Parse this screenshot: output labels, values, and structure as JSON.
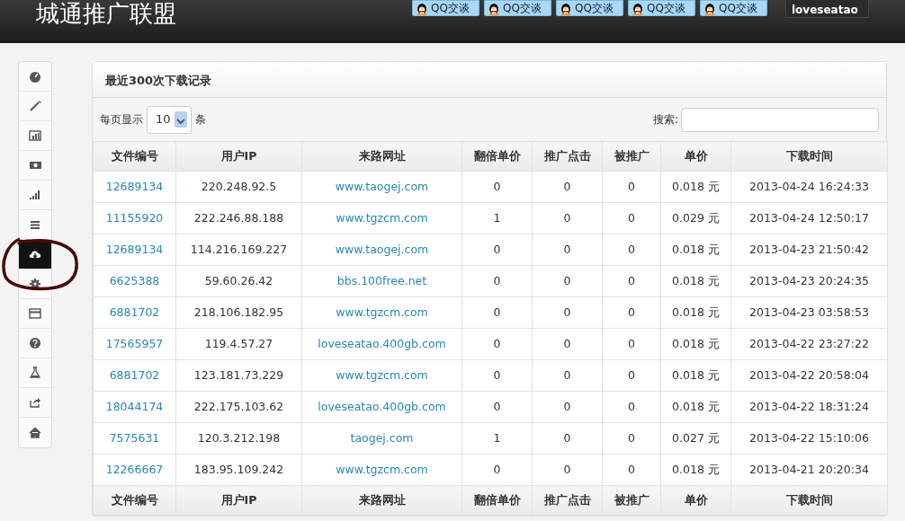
{
  "header": {
    "title": "城通推广联盟",
    "chat_buttons": [
      "QQ交谈",
      "QQ交谈",
      "QQ交谈",
      "QQ交谈",
      "QQ交谈"
    ],
    "username": "loveseatao"
  },
  "sidebar": {
    "items": [
      {
        "kind": "gauge",
        "selected": false
      },
      {
        "kind": "wand",
        "selected": false
      },
      {
        "kind": "chart",
        "selected": false
      },
      {
        "kind": "money",
        "selected": false
      },
      {
        "kind": "signal",
        "selected": false
      },
      {
        "kind": "list",
        "selected": false
      },
      {
        "kind": "cloud",
        "selected": true
      },
      {
        "kind": "gear",
        "selected": false
      },
      {
        "kind": "card",
        "selected": false
      },
      {
        "kind": "question",
        "selected": false
      },
      {
        "kind": "flask",
        "selected": false
      },
      {
        "kind": "share",
        "selected": false
      },
      {
        "kind": "home",
        "selected": false
      }
    ]
  },
  "panel": {
    "title": "最近300次下载记录",
    "page_size": {
      "before": "每页显示",
      "value": "10",
      "after": "条"
    },
    "search": {
      "label": "搜索:"
    },
    "table": {
      "columns": [
        "文件编号",
        "用户IP",
        "来路网址",
        "翻倍单价",
        "推广点击",
        "被推广",
        "单价",
        "下载时间"
      ],
      "rows": [
        [
          "12689134",
          "220.248.92.5",
          "www.taogej.com",
          "0",
          "0",
          "0",
          "0.018 元",
          "2013-04-24 16:24:33"
        ],
        [
          "11155920",
          "222.246.88.188",
          "www.tgzcm.com",
          "1",
          "0",
          "0",
          "0.029 元",
          "2013-04-24 12:50:17"
        ],
        [
          "12689134",
          "114.216.169.227",
          "www.taogej.com",
          "0",
          "0",
          "0",
          "0.018 元",
          "2013-04-23 21:50:42"
        ],
        [
          "6625388",
          "59.60.26.42",
          "bbs.100free.net",
          "0",
          "0",
          "0",
          "0.018 元",
          "2013-04-23 20:24:35"
        ],
        [
          "6881702",
          "218.106.182.95",
          "www.tgzcm.com",
          "0",
          "0",
          "0",
          "0.018 元",
          "2013-04-23 03:58:53"
        ],
        [
          "17565957",
          "119.4.57.27",
          "loveseatao.400gb.com",
          "0",
          "0",
          "0",
          "0.018 元",
          "2013-04-22 23:27:22"
        ],
        [
          "6881702",
          "123.181.73.229",
          "www.tgzcm.com",
          "0",
          "0",
          "0",
          "0.018 元",
          "2013-04-22 20:58:04"
        ],
        [
          "18044174",
          "222.175.103.62",
          "loveseatao.400gb.com",
          "0",
          "0",
          "0",
          "0.018 元",
          "2013-04-22 18:31:24"
        ],
        [
          "7575631",
          "120.3.212.198",
          "taogej.com",
          "1",
          "0",
          "0",
          "0.027 元",
          "2013-04-22 15:10:06"
        ],
        [
          "12266667",
          "183.95.109.242",
          "www.tgzcm.com",
          "0",
          "0",
          "0",
          "0.018 元",
          "2013-04-21 20:20:34"
        ]
      ],
      "footer_columns": [
        "文件编号",
        "用户IP",
        "来路网址",
        "翻倍单价",
        "推广点击",
        "被推广",
        "单价",
        "下载时间"
      ]
    }
  }
}
